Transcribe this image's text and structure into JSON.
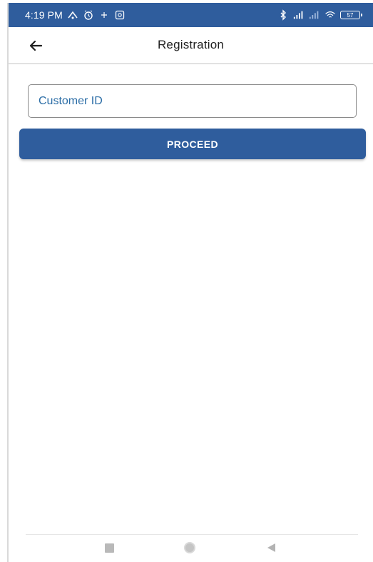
{
  "status_bar": {
    "time": "4:19 PM",
    "battery_level": "57",
    "background_color": "#2f5d9d",
    "left_icons": [
      "notification-icon",
      "alarm-icon",
      "dot-icon",
      "photo-icon"
    ],
    "right_icons": [
      "bluetooth-icon",
      "signal-icon",
      "signal-icon",
      "wifi-icon",
      "battery-icon"
    ]
  },
  "app_bar": {
    "title": "Registration",
    "back_icon": "arrow-left-icon"
  },
  "form": {
    "customer_id_placeholder": "Customer ID",
    "customer_id_value": ""
  },
  "actions": {
    "proceed_label": "PROCEED",
    "proceed_color": "#2f5d9d"
  },
  "navigation": {
    "icons": [
      "recent-apps-icon",
      "home-icon",
      "back-icon"
    ]
  }
}
